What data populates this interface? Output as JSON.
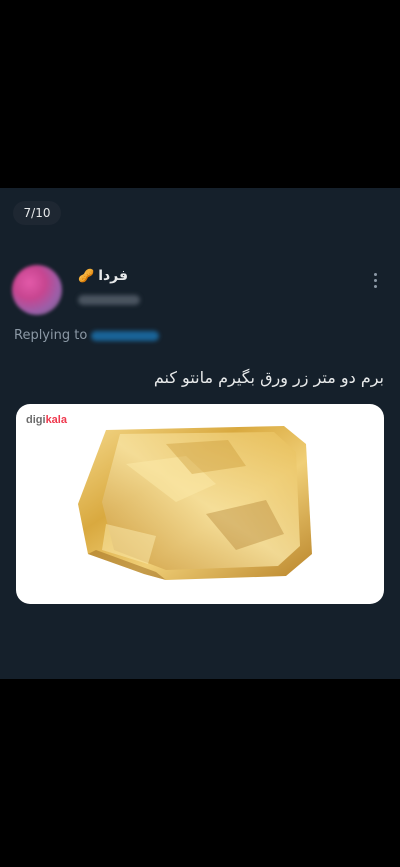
{
  "thread": {
    "counter": "7/10"
  },
  "tweet": {
    "display_name": "فردا",
    "name_icon": "peanut-icon",
    "replying_label": "Replying to",
    "text": "برم دو متر زر ورق بگیرم مانتو کنم",
    "media": {
      "logo_prefix": "digi",
      "logo_suffix": "kala",
      "description": "gold leaf sheets"
    }
  },
  "colors": {
    "page_background": "#000000",
    "card_background": "#15202b",
    "primary_text": "#e7e9ea",
    "secondary_text": "#8b98a5",
    "link": "#1d9bf0",
    "brand_red": "#ef394e"
  }
}
